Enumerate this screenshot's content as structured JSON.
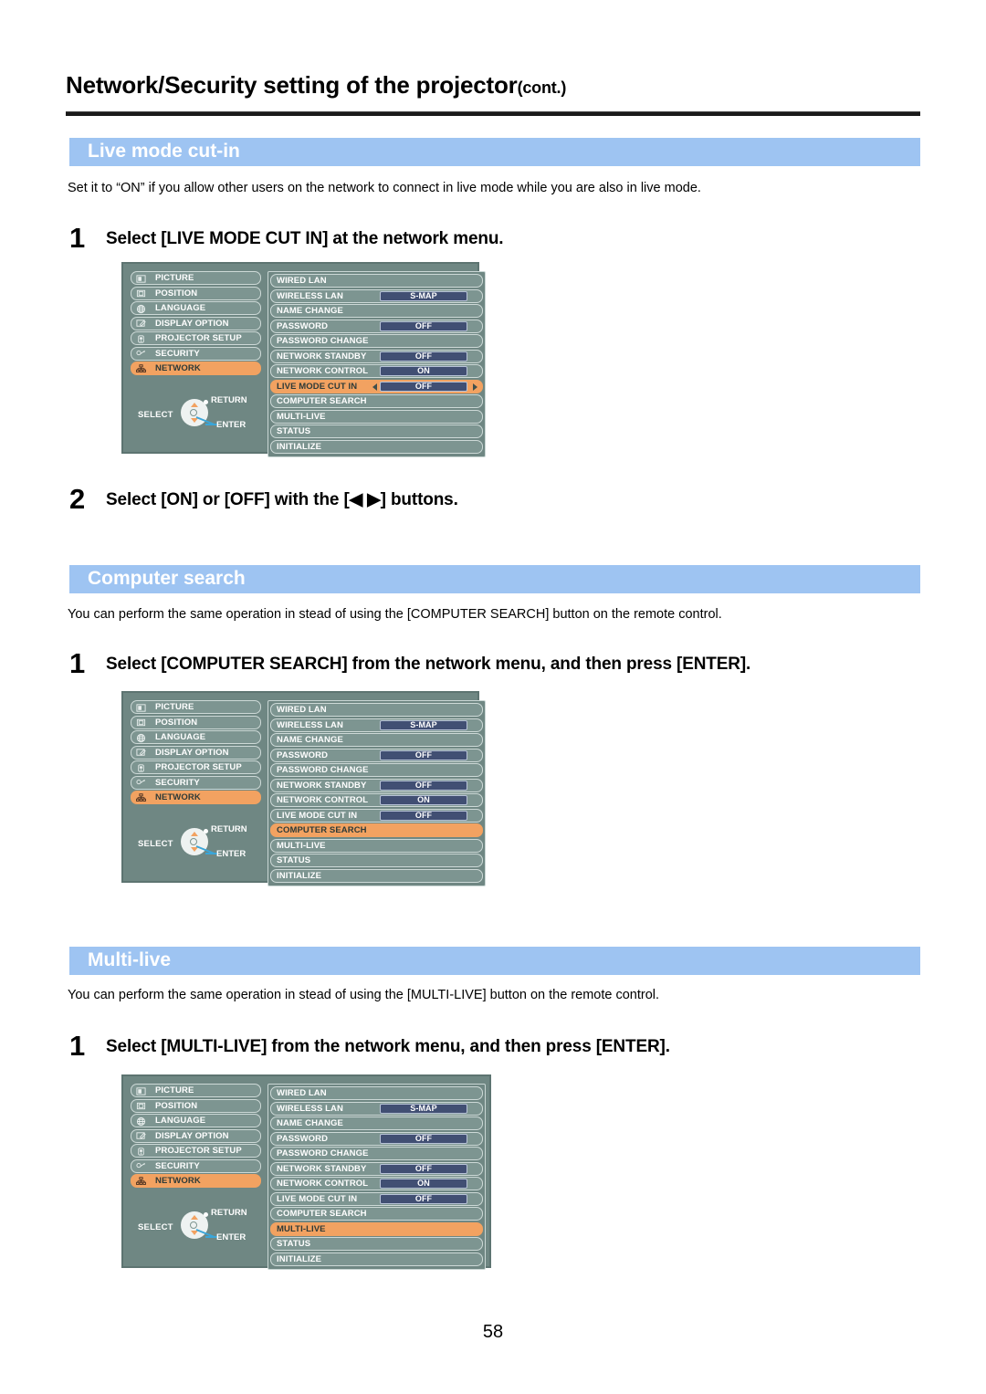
{
  "page": {
    "title": "Network/Security setting of the projector",
    "title_suffix": "(cont.)",
    "page_number": "58"
  },
  "colors": {
    "band": "#9ec4f2",
    "menu_bg": "#6f8783",
    "menu_row": "#7d9591",
    "highlight": "#f2a261",
    "value_pill": "#414f73"
  },
  "osd_sidebar": [
    {
      "label": "PICTURE",
      "icon": "picture-icon",
      "selected": false
    },
    {
      "label": "POSITION",
      "icon": "position-icon",
      "selected": false
    },
    {
      "label": "LANGUAGE",
      "icon": "globe-icon",
      "selected": false
    },
    {
      "label": "DISPLAY OPTION",
      "icon": "display-option-icon",
      "selected": false
    },
    {
      "label": "PROJECTOR SETUP",
      "icon": "projector-icon",
      "selected": false
    },
    {
      "label": "SECURITY",
      "icon": "key-icon",
      "selected": false
    },
    {
      "label": "NETWORK",
      "icon": "network-tree-icon",
      "selected": true
    }
  ],
  "osd_nav": {
    "select_label": "SELECT",
    "return_label": "RETURN",
    "enter_label": "ENTER"
  },
  "sections": [
    {
      "heading": "Live mode cut-in",
      "paragraph": "Set it to “ON” if you allow other users on the network to connect in live mode while you are also in live mode.",
      "steps": [
        {
          "num": "1",
          "text": "Select [LIVE MODE CUT IN] at the network menu."
        },
        {
          "num": "2",
          "text": "Select [ON] or [OFF] with the [◀ ▶] buttons."
        }
      ],
      "menu": {
        "selected_row": "LIVE MODE CUT IN",
        "show_arrows": true,
        "rows": [
          {
            "label": "WIRED LAN",
            "value": ""
          },
          {
            "label": "WIRELESS LAN",
            "value": "S-MAP"
          },
          {
            "label": "NAME CHANGE",
            "value": ""
          },
          {
            "label": "PASSWORD",
            "value": "OFF"
          },
          {
            "label": "PASSWORD CHANGE",
            "value": ""
          },
          {
            "label": "NETWORK STANDBY",
            "value": "OFF"
          },
          {
            "label": "NETWORK CONTROL",
            "value": "ON"
          },
          {
            "label": "LIVE MODE CUT IN",
            "value": "OFF"
          },
          {
            "label": "COMPUTER SEARCH",
            "value": ""
          },
          {
            "label": "MULTI-LIVE",
            "value": ""
          },
          {
            "label": "STATUS",
            "value": ""
          },
          {
            "label": "INITIALIZE",
            "value": ""
          }
        ]
      }
    },
    {
      "heading": "Computer search",
      "paragraph": "You can perform the same operation in stead of using the [COMPUTER SEARCH] button on the remote control.",
      "steps": [
        {
          "num": "1",
          "text": "Select [COMPUTER SEARCH] from the network menu, and then press [ENTER]."
        }
      ],
      "menu": {
        "selected_row": "COMPUTER SEARCH",
        "show_arrows": false,
        "rows": [
          {
            "label": "WIRED LAN",
            "value": ""
          },
          {
            "label": "WIRELESS LAN",
            "value": "S-MAP"
          },
          {
            "label": "NAME CHANGE",
            "value": ""
          },
          {
            "label": "PASSWORD",
            "value": "OFF"
          },
          {
            "label": "PASSWORD CHANGE",
            "value": ""
          },
          {
            "label": "NETWORK STANDBY",
            "value": "OFF"
          },
          {
            "label": "NETWORK CONTROL",
            "value": "ON"
          },
          {
            "label": "LIVE MODE CUT IN",
            "value": "OFF"
          },
          {
            "label": "COMPUTER SEARCH",
            "value": ""
          },
          {
            "label": "MULTI-LIVE",
            "value": ""
          },
          {
            "label": "STATUS",
            "value": ""
          },
          {
            "label": "INITIALIZE",
            "value": ""
          }
        ]
      }
    },
    {
      "heading": "Multi-live",
      "paragraph": "You can perform the same operation in stead of using the [MULTI-LIVE] button on the remote control.",
      "steps": [
        {
          "num": "1",
          "text": "Select [MULTI-LIVE] from the network menu, and then press [ENTER]."
        }
      ],
      "menu": {
        "selected_row": "MULTI-LIVE",
        "show_arrows": false,
        "rows": [
          {
            "label": "WIRED LAN",
            "value": ""
          },
          {
            "label": "WIRELESS LAN",
            "value": "S-MAP"
          },
          {
            "label": "NAME CHANGE",
            "value": ""
          },
          {
            "label": "PASSWORD",
            "value": "OFF"
          },
          {
            "label": "PASSWORD CHANGE",
            "value": ""
          },
          {
            "label": "NETWORK STANDBY",
            "value": "OFF"
          },
          {
            "label": "NETWORK CONTROL",
            "value": "ON"
          },
          {
            "label": "LIVE MODE CUT IN",
            "value": "OFF"
          },
          {
            "label": "COMPUTER SEARCH",
            "value": ""
          },
          {
            "label": "MULTI-LIVE",
            "value": ""
          },
          {
            "label": "STATUS",
            "value": ""
          },
          {
            "label": "INITIALIZE",
            "value": ""
          }
        ]
      }
    }
  ]
}
